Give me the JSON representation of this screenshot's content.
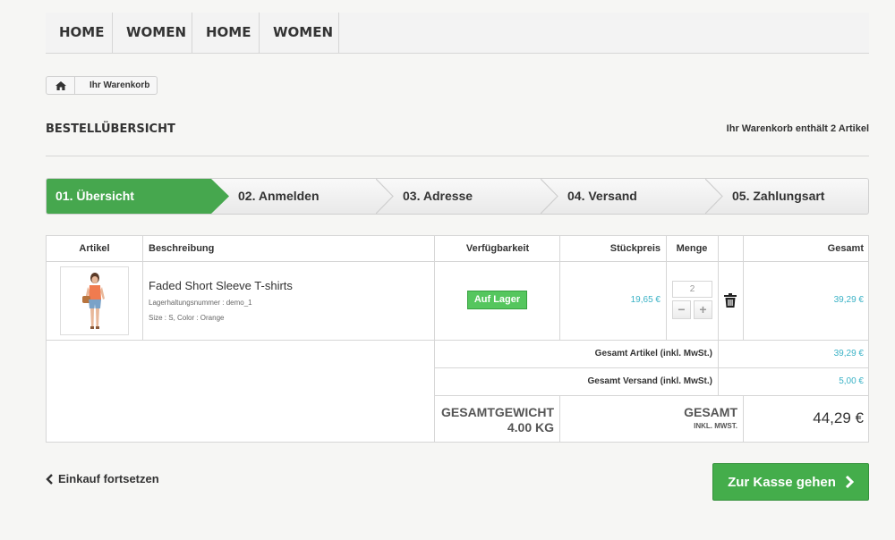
{
  "nav": {
    "items": [
      "HOME",
      "WOMEN",
      "HOME",
      "WOMEN"
    ]
  },
  "breadcrumb": {
    "home_icon": "home-icon",
    "current": "Ihr Warenkorb"
  },
  "page": {
    "title": "BESTELLÜBERSICHT",
    "cart_count": "Ihr Warenkorb enthält 2 Artikel"
  },
  "steps": [
    "01. Übersicht",
    "02. Anmelden",
    "03. Adresse",
    "04. Versand",
    "05. Zahlungsart"
  ],
  "table": {
    "headers": {
      "item": "Artikel",
      "description": "Beschreibung",
      "availability": "Verfügbarkeit",
      "unit_price": "Stückpreis",
      "quantity": "Menge",
      "total": "Gesamt"
    },
    "product": {
      "name": "Faded Short Sleeve T-shirts",
      "reference": "Lagerhaltungsnummer : demo_1",
      "attributes": "Size : S, Color : Orange",
      "availability": "Auf Lager",
      "unit_price": "19,65 €",
      "quantity": "2",
      "total": "39,29 €"
    },
    "summary": {
      "products_label": "Gesamt Artikel (inkl. MwSt.)",
      "products_value": "39,29 €",
      "shipping_label": "Gesamt Versand (inkl. MwSt.)",
      "shipping_value": "5,00 €",
      "weight_label": "GESAMTGEWICHT",
      "weight_value": "4.00 KG",
      "grand_label": "GESAMT",
      "grand_sublabel": "INKL. MWST.",
      "grand_value": "44,29 €"
    }
  },
  "actions": {
    "continue": "Einkauf fortsetzen",
    "checkout": "Zur Kasse gehen"
  },
  "colors": {
    "accent_green": "#46a74e",
    "price_teal": "#3bb2c6"
  }
}
